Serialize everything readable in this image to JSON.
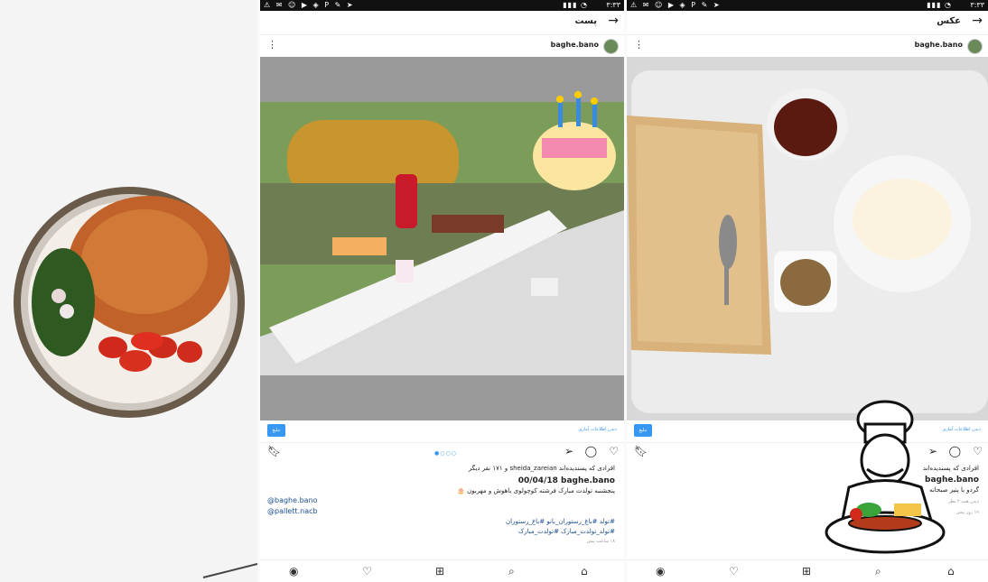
{
  "status": {
    "time": "۳:۳۳",
    "battery": "۳۳٪"
  },
  "panels": [
    {
      "title": "پست",
      "username": "baghe.bano",
      "info_button": "تبلیغ",
      "info_link": "دیدن اطلاعات آماری",
      "liked_by": "افرادی که پسندیده‌اند sheida_zareian و ۱۷۱ نفر دیگر",
      "caption_user": "baghe.bano",
      "caption_date": "00/04/18",
      "caption_day": "پنجشنبه",
      "caption_text": "تولدت مبارک فرشته کوچولوی باهوش و مهربون 🎂",
      "mentions": [
        "@baghe.bano",
        "@pallett.nacb"
      ],
      "hashtags_1": "#تولد #باغ_رستوران_بانو #باغ_رستوران",
      "hashtags_2": "#تولد_تولدت_مبارک #تولدت_مبارک",
      "time_ago": "۱۸ ساعت پیش"
    },
    {
      "title": "عکس",
      "username": "baghe.bano",
      "info_button": "تبلیغ",
      "info_link": "دیدن اطلاعات آماری",
      "liked_by": "افرادی که پسندیده‌اند",
      "caption_user": "baghe.bano",
      "caption_text": "گردو با پنیر صبحانه",
      "comments_link": "دیدن همه ۲ نظر",
      "time_ago": "۱۹ روز پیش"
    }
  ],
  "colors": {
    "accent": "#3897f0"
  }
}
